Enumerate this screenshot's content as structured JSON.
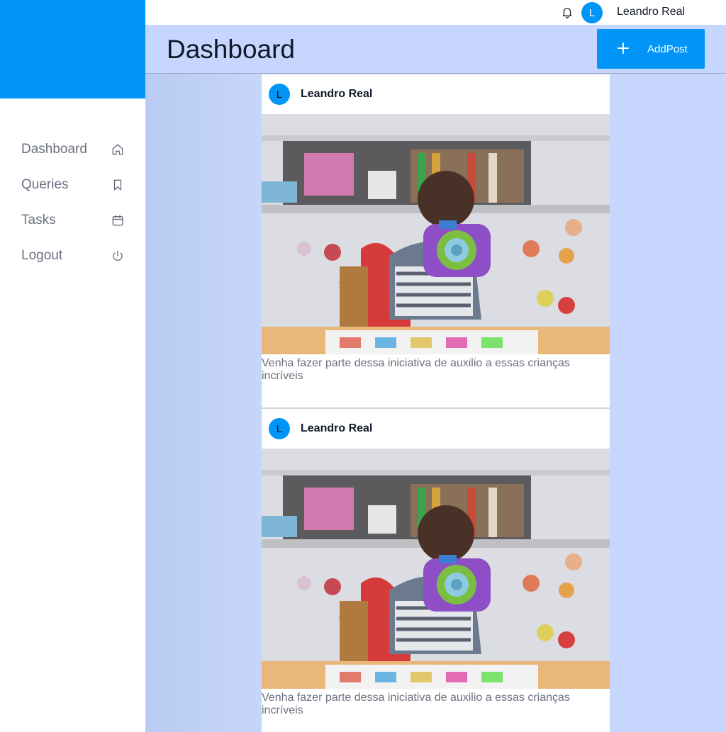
{
  "topbar": {
    "username": "Leandro Real",
    "avatar_initial": "L",
    "icons": [
      "bell-icon"
    ]
  },
  "sidebar": {
    "items": [
      {
        "label": "Dashboard",
        "icon": "home-icon"
      },
      {
        "label": "Queries",
        "icon": "bookmark-icon"
      },
      {
        "label": "Tasks",
        "icon": "calendar-icon"
      },
      {
        "label": "Logout",
        "icon": "power-icon"
      }
    ]
  },
  "header": {
    "title": "Dashboard",
    "add_button_label": "AddPost"
  },
  "posts": [
    {
      "author": "Leandro Real",
      "avatar_initial": "L",
      "caption": "Venha fazer parte dessa iniciativa de auxilio a essas crianças incríveis"
    },
    {
      "author": "Leandro Real",
      "avatar_initial": "L",
      "caption": "Venha fazer parte dessa iniciativa de auxilio a essas crianças incríveis"
    }
  ],
  "colors": {
    "accent": "#0095f6",
    "main_background": "#c6d6fe"
  }
}
